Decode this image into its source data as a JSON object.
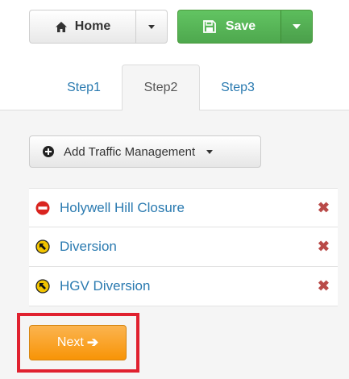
{
  "toolbar": {
    "home_label": "Home",
    "save_label": "Save",
    "save_color": "#5cb85c"
  },
  "tabs": [
    {
      "label": "Step1",
      "active": false
    },
    {
      "label": "Step2",
      "active": true
    },
    {
      "label": "Step3",
      "active": false
    }
  ],
  "panel": {
    "add_button_label": "Add Traffic Management",
    "items": [
      {
        "label": "Holywell Hill Closure",
        "icon": "no-entry-icon",
        "remove_glyph": "✖"
      },
      {
        "label": "Diversion",
        "icon": "diversion-arrow-icon",
        "remove_glyph": "✖"
      },
      {
        "label": "HGV Diversion",
        "icon": "diversion-arrow-icon",
        "remove_glyph": "✖"
      }
    ],
    "next_label": "Next",
    "next_arrow": "➔",
    "next_color": "#f89406",
    "highlight_color": "#e0212f"
  }
}
